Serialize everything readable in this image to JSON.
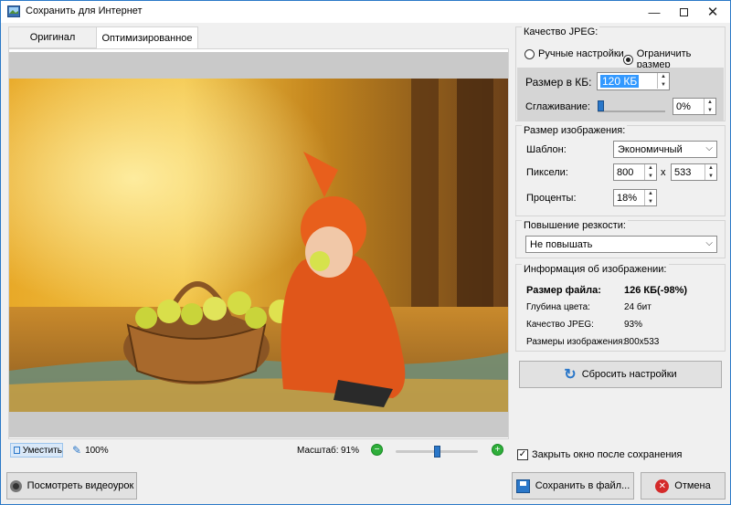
{
  "window": {
    "title": "Сохранить для Интернет"
  },
  "tabs": [
    {
      "label": "Оригинал"
    },
    {
      "label": "Оптимизированное"
    }
  ],
  "status": {
    "fit_label": "Уместить",
    "zoom100_label": "100%",
    "scale_label": "Масштаб:",
    "scale_value": "91%",
    "zoom_level": 0.5
  },
  "jpeg": {
    "group_label": "Качество JPEG:",
    "mode_manual": "Ручные настройки",
    "mode_limit": "Ограничить размер",
    "size_label": "Размер в КБ:",
    "size_value": "120 КБ",
    "smoothing_label": "Сглаживание:",
    "smoothing_value": "0%",
    "smoothing_level": 0
  },
  "image_size": {
    "group_label": "Размер изображения:",
    "template_label": "Шаблон:",
    "template_value": "Экономичный",
    "pixels_label": "Пиксели:",
    "width": "800",
    "times": "x",
    "height": "533",
    "percent_label": "Проценты:",
    "percent_value": "18%"
  },
  "sharpen": {
    "group_label": "Повышение резкости:",
    "value": "Не повышать"
  },
  "info": {
    "group_label": "Информация об изображении:",
    "file_size_label": "Размер файла:",
    "file_size_value": "126 КБ(-98%)",
    "depth_label": "Глубина цвета:",
    "depth_value": "24 бит",
    "quality_label": "Качество JPEG:",
    "quality_value": "93%",
    "dims_label": "Размеры изображения:",
    "dims_value": "800x533"
  },
  "buttons": {
    "reset": "Сбросить настройки",
    "close_after_save": "Закрыть окно после сохранения",
    "video": "Посмотреть видеоурок",
    "save": "Сохранить в файл...",
    "cancel": "Отмена"
  },
  "colors": {
    "accent": "#2a77c9",
    "selection": "#3399ff",
    "zoom_green": "#2fae3b",
    "cancel_red": "#d42a2a"
  }
}
